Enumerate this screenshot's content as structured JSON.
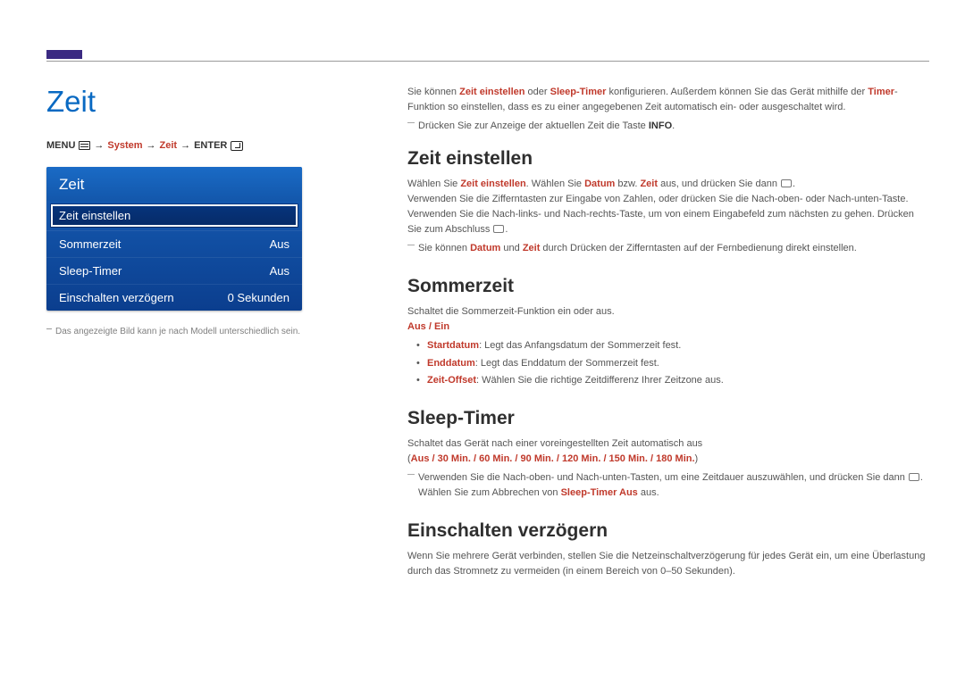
{
  "pageTitle": "Zeit",
  "breadcrumb": {
    "menu": "MENU",
    "arrow": "→",
    "system": "System",
    "zeit": "Zeit",
    "enter": "ENTER"
  },
  "osd": {
    "title": "Zeit",
    "items": [
      {
        "label": "Zeit einstellen",
        "value": "",
        "selected": true
      },
      {
        "label": "Sommerzeit",
        "value": "Aus",
        "selected": false
      },
      {
        "label": "Sleep-Timer",
        "value": "Aus",
        "selected": false
      },
      {
        "label": "Einschalten verzögern",
        "value": "0 Sekunden",
        "selected": false
      }
    ],
    "note": "Das angezeigte Bild kann je nach Modell unterschiedlich sein."
  },
  "intro": {
    "p1_a": "Sie können ",
    "p1_b": "Zeit einstellen",
    "p1_c": " oder ",
    "p1_d": "Sleep-Timer",
    "p1_e": " konfigurieren. Außerdem können Sie das Gerät mithilfe der ",
    "p1_f": "Timer",
    "p1_g": "-Funktion so einstellen, dass es zu einer angegebenen Zeit automatisch ein- oder ausgeschaltet wird.",
    "note_a": "Drücken Sie zur Anzeige der aktuellen Zeit die Taste ",
    "note_b": "INFO",
    "note_c": "."
  },
  "sec1": {
    "h": "Zeit einstellen",
    "p1_a": "Wählen Sie ",
    "p1_b": "Zeit einstellen",
    "p1_c": ". Wählen Sie ",
    "p1_d": "Datum",
    "p1_e": " bzw. ",
    "p1_f": "Zeit",
    "p1_g": " aus, und drücken Sie dann ",
    "p1_h": ".",
    "p2": "Verwenden Sie die Zifferntasten zur Eingabe von Zahlen, oder drücken Sie die Nach-oben- oder Nach-unten-Taste. Verwenden Sie die Nach-links- und Nach-rechts-Taste, um von einem Eingabefeld zum nächsten zu gehen. Drücken Sie zum Abschluss ",
    "p2_end": ".",
    "note_a": "Sie können ",
    "note_b": "Datum",
    "note_c": " und ",
    "note_d": "Zeit",
    "note_e": " durch Drücken der Zifferntasten auf der Fernbedienung direkt einstellen."
  },
  "sec2": {
    "h": "Sommerzeit",
    "p1": "Schaltet die Sommerzeit-Funktion ein oder aus.",
    "toggle": "Aus / Ein",
    "li1_a": "Startdatum",
    "li1_b": ": Legt das Anfangsdatum der Sommerzeit fest.",
    "li2_a": "Enddatum",
    "li2_b": ": Legt das Enddatum der Sommerzeit fest.",
    "li3_a": "Zeit-Offset",
    "li3_b": ": Wählen Sie die richtige Zeitdifferenz Ihrer Zeitzone aus."
  },
  "sec3": {
    "h": "Sleep-Timer",
    "p1": "Schaltet das Gerät nach einer voreingestellten Zeit automatisch aus",
    "opts_a": "(",
    "opts_b": "Aus / 30 Min. / 60 Min. / 90 Min. / 120 Min. / 150 Min. / 180 Min.",
    "opts_c": ")",
    "note_a": "Verwenden Sie die Nach-oben- und Nach-unten-Tasten, um eine Zeitdauer auszuwählen, und drücken Sie dann ",
    "note_b": ". Wählen Sie zum Abbrechen von ",
    "note_c": "Sleep-Timer Aus",
    "note_d": " aus."
  },
  "sec4": {
    "h": "Einschalten verzögern",
    "p1": "Wenn Sie mehrere Gerät verbinden, stellen Sie die Netzeinschaltverzögerung für jedes Gerät ein, um eine Überlastung durch das Stromnetz zu vermeiden (in einem Bereich von 0–50 Sekunden)."
  }
}
